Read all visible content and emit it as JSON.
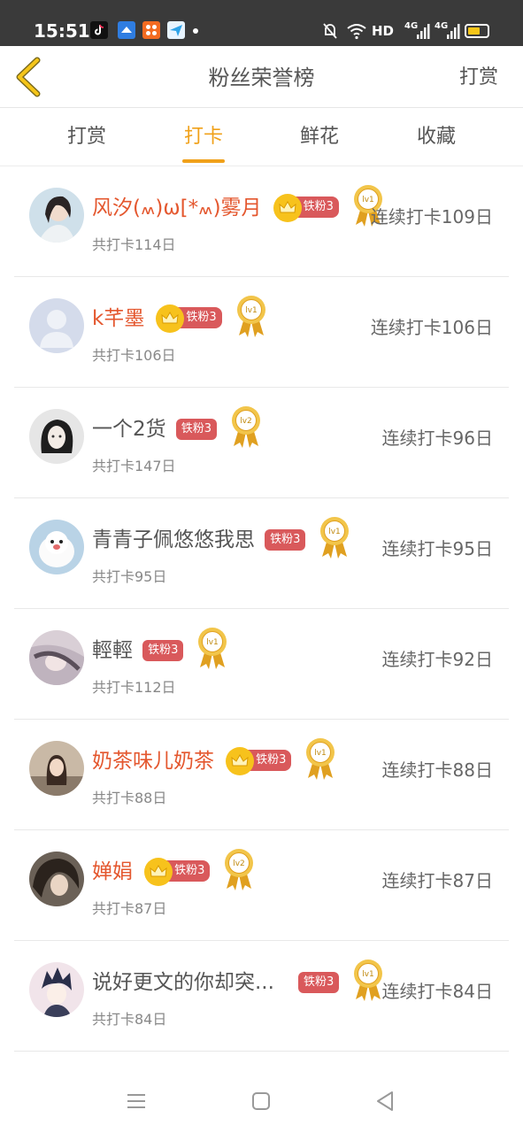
{
  "status_bar": {
    "time": "15:51",
    "hd_label": "HD",
    "net_1": "4G",
    "net_2": "4G"
  },
  "header": {
    "title": "粉丝荣誉榜",
    "action": "打赏",
    "back_icon": "chevron-left-icon"
  },
  "tabs": [
    {
      "label": "打赏",
      "active": false
    },
    {
      "label": "打卡",
      "active": true
    },
    {
      "label": "鲜花",
      "active": false
    },
    {
      "label": "收藏",
      "active": false
    }
  ],
  "colors": {
    "accent": "#f0a11a",
    "vip_name": "#e4572e",
    "fan_badge": "#d9595b",
    "crown": "#f7c21c"
  },
  "rows": [
    {
      "name": "风汐(៳)ω[*៳)雾月",
      "vip": true,
      "fan_badge": "铁粉3",
      "medal": "lv1",
      "total": "共打卡114日",
      "streak": "连续打卡109日"
    },
    {
      "name": "k芊墨",
      "vip": true,
      "fan_badge": "铁粉3",
      "medal": "lv1",
      "total": "共打卡106日",
      "streak": "连续打卡106日"
    },
    {
      "name": "一个2货",
      "vip": false,
      "fan_badge": "铁粉3",
      "medal": "lv2",
      "total": "共打卡147日",
      "streak": "连续打卡96日"
    },
    {
      "name": "青青子佩悠悠我思",
      "vip": false,
      "fan_badge": "铁粉3",
      "medal": "lv1",
      "total": "共打卡95日",
      "streak": "连续打卡95日"
    },
    {
      "name": "輕輕",
      "vip": false,
      "fan_badge": "铁粉3",
      "medal": "lv1",
      "total": "共打卡112日",
      "streak": "连续打卡92日"
    },
    {
      "name": "奶茶味儿奶茶",
      "vip": true,
      "fan_badge": "铁粉3",
      "medal": "lv1",
      "total": "共打卡88日",
      "streak": "连续打卡88日"
    },
    {
      "name": "婵娟",
      "vip": true,
      "fan_badge": "铁粉3",
      "medal": "lv2",
      "total": "共打卡87日",
      "streak": "连续打卡87日"
    },
    {
      "name": "说好更文的你却突...",
      "vip": false,
      "fan_badge": "铁粉3",
      "medal": "lv1",
      "total": "共打卡84日",
      "streak": "连续打卡84日"
    }
  ]
}
